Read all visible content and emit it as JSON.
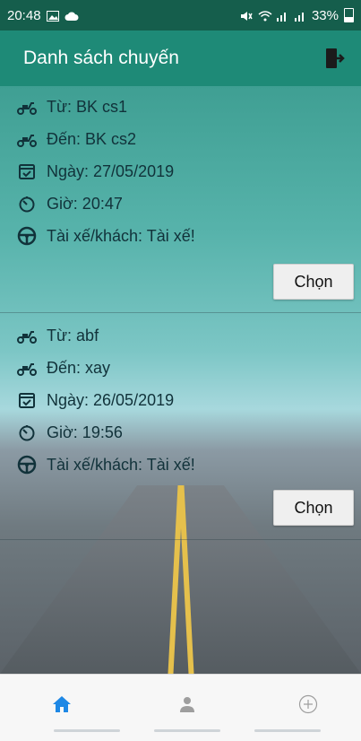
{
  "status_bar": {
    "time": "20:48",
    "battery": "33%"
  },
  "app_bar": {
    "title": "Danh sách chuyến"
  },
  "trips": [
    {
      "from": "Từ: BK cs1",
      "to": "Đến: BK cs2",
      "date": "Ngày: 27/05/2019",
      "time": "Giờ: 20:47",
      "role": "Tài xế/khách: Tài xế!",
      "choose_label": "Chọn"
    },
    {
      "from": "Từ: abf",
      "to": "Đến: xay",
      "date": "Ngày: 26/05/2019",
      "time": "Giờ: 19:56",
      "role": "Tài xế/khách: Tài xế!",
      "choose_label": "Chọn"
    }
  ],
  "bottom_nav": {
    "items": [
      {
        "icon": "home-icon",
        "active": true
      },
      {
        "icon": "person-icon",
        "active": false
      },
      {
        "icon": "add-circle-icon",
        "active": false
      }
    ],
    "active_color": "#1e88e5",
    "inactive_color": "#9e9e9e"
  },
  "colors": {
    "status_bar": "#155e4c",
    "app_bar": "#1e8a77",
    "text": "#11323a"
  }
}
